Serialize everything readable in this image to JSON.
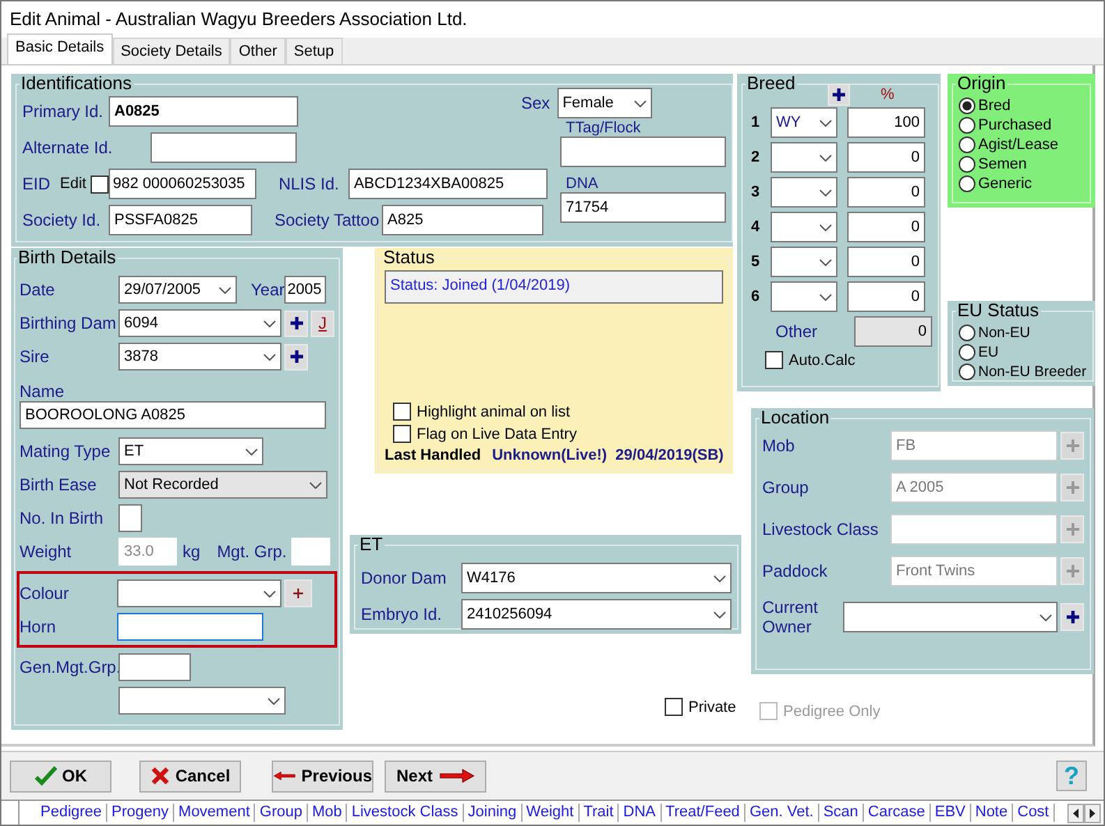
{
  "window": {
    "title": "Edit Animal - Australian Wagyu Breeders Association Ltd."
  },
  "tabs": [
    {
      "label": "Basic Details",
      "selected": true
    },
    {
      "label": "Society Details",
      "selected": false
    },
    {
      "label": "Other",
      "selected": false
    },
    {
      "label": "Setup",
      "selected": false
    }
  ],
  "identifications": {
    "title": "Identifications",
    "primary_id": {
      "label": "Primary Id.",
      "value": "A0825"
    },
    "alternate_id": {
      "label": "Alternate Id."
    },
    "eid": {
      "label": "EID",
      "edit_label": "Edit",
      "edit_checked": false,
      "value": "982 000060253035"
    },
    "society_id": {
      "label": "Society Id.",
      "value": "PSSFA0825"
    },
    "nlis_id": {
      "label": "NLIS Id.",
      "value": "ABCD1234XBA00825"
    },
    "society_tattoo": {
      "label": "Society Tattoo",
      "value": "A825"
    },
    "sex": {
      "label": "Sex",
      "value": "Female"
    },
    "ttag_flock": {
      "label": "TTag/Flock"
    },
    "dna": {
      "label": "DNA",
      "value": "71754"
    }
  },
  "birth_details": {
    "title": "Birth Details",
    "date": {
      "label": "Date",
      "value": "29/07/2005"
    },
    "year": {
      "label": "Year",
      "value": "2005"
    },
    "birthing_dam": {
      "label": "Birthing Dam",
      "value": "6094",
      "j_button": "J"
    },
    "sire": {
      "label": "Sire",
      "value": "3878"
    },
    "name": {
      "label": "Name",
      "value": "BOOROOLONG A0825"
    },
    "mating_type": {
      "label": "Mating Type",
      "value": "ET"
    },
    "birth_ease": {
      "label": "Birth Ease",
      "value": "Not Recorded",
      "disabled": true
    },
    "no_in_birth": {
      "label": "No. In Birth"
    },
    "weight": {
      "label": "Weight",
      "value": "33.0",
      "unit": "kg",
      "disabled": true
    },
    "mgt_grp": {
      "label": "Mgt. Grp."
    },
    "colour": {
      "label": "Colour"
    },
    "horn": {
      "label": "Horn",
      "focused": true
    },
    "gen_mgt_grp": {
      "label": "Gen.Mgt.Grp."
    },
    "colour_horn_outlined": true
  },
  "status": {
    "title": "Status",
    "status_text": "Status: Joined (1/04/2019)",
    "highlight": {
      "label": "Highlight animal on list",
      "checked": false
    },
    "flag": {
      "label": "Flag on Live Data Entry",
      "checked": false
    },
    "last_handled_label": "Last Handled",
    "last_handled_value": "Unknown(Live!)  29/04/2019(SB)"
  },
  "et": {
    "title": "ET",
    "donor_dam": {
      "label": "Donor Dam",
      "value": "W4176"
    },
    "embryo_id": {
      "label": "Embryo Id.",
      "value": "2410256094"
    }
  },
  "private": {
    "label": "Private",
    "checked": false
  },
  "breed": {
    "title": "Breed",
    "percent_header": "%",
    "rows": [
      {
        "index": "1",
        "code": "WY",
        "percent": "100"
      },
      {
        "index": "2",
        "percent": "0"
      },
      {
        "index": "3",
        "percent": "0"
      },
      {
        "index": "4",
        "percent": "0"
      },
      {
        "index": "5",
        "percent": "0"
      },
      {
        "index": "6",
        "percent": "0"
      }
    ],
    "other": {
      "label": "Other",
      "value": "0"
    },
    "auto_calc": {
      "label": "Auto.Calc",
      "checked": false
    }
  },
  "origin": {
    "title": "Origin",
    "options": [
      {
        "label": "Bred",
        "selected": true
      },
      {
        "label": "Purchased",
        "selected": false
      },
      {
        "label": "Agist/Lease",
        "selected": false
      },
      {
        "label": "Semen",
        "selected": false
      },
      {
        "label": "Generic",
        "selected": false
      }
    ]
  },
  "eu_status": {
    "title": "EU Status",
    "options": [
      {
        "label": "Non-EU",
        "selected": false
      },
      {
        "label": "EU",
        "selected": false
      },
      {
        "label": "Non-EU Breeder",
        "selected": false
      }
    ]
  },
  "location": {
    "title": "Location",
    "fields": [
      {
        "label": "Mob",
        "value": "FB",
        "disabled": true
      },
      {
        "label": "Group",
        "value": "A 2005",
        "disabled": true
      },
      {
        "label": "Livestock Class",
        "disabled": true
      },
      {
        "label": "Paddock",
        "value": "Front Twins",
        "disabled": true
      }
    ],
    "current_owner": {
      "label": "Current Owner"
    }
  },
  "pedigree_only": {
    "label": "Pedigree Only",
    "checked": false,
    "disabled": true
  },
  "buttons": [
    {
      "kind": "ok",
      "label": "OK"
    },
    {
      "kind": "cancel",
      "label": "Cancel"
    },
    {
      "kind": "previous",
      "label": "Previous"
    },
    {
      "kind": "next",
      "label": "Next"
    }
  ],
  "help": "?",
  "record_tabs": [
    "Pedigree",
    "Progeny",
    "Movement",
    "Group",
    "Mob",
    "Livestock Class",
    "Joining",
    "Weight",
    "Trait",
    "DNA",
    "Treat/Feed",
    "Gen. Vet.",
    "Scan",
    "Carcase",
    "EBV",
    "Note",
    "Cost"
  ]
}
